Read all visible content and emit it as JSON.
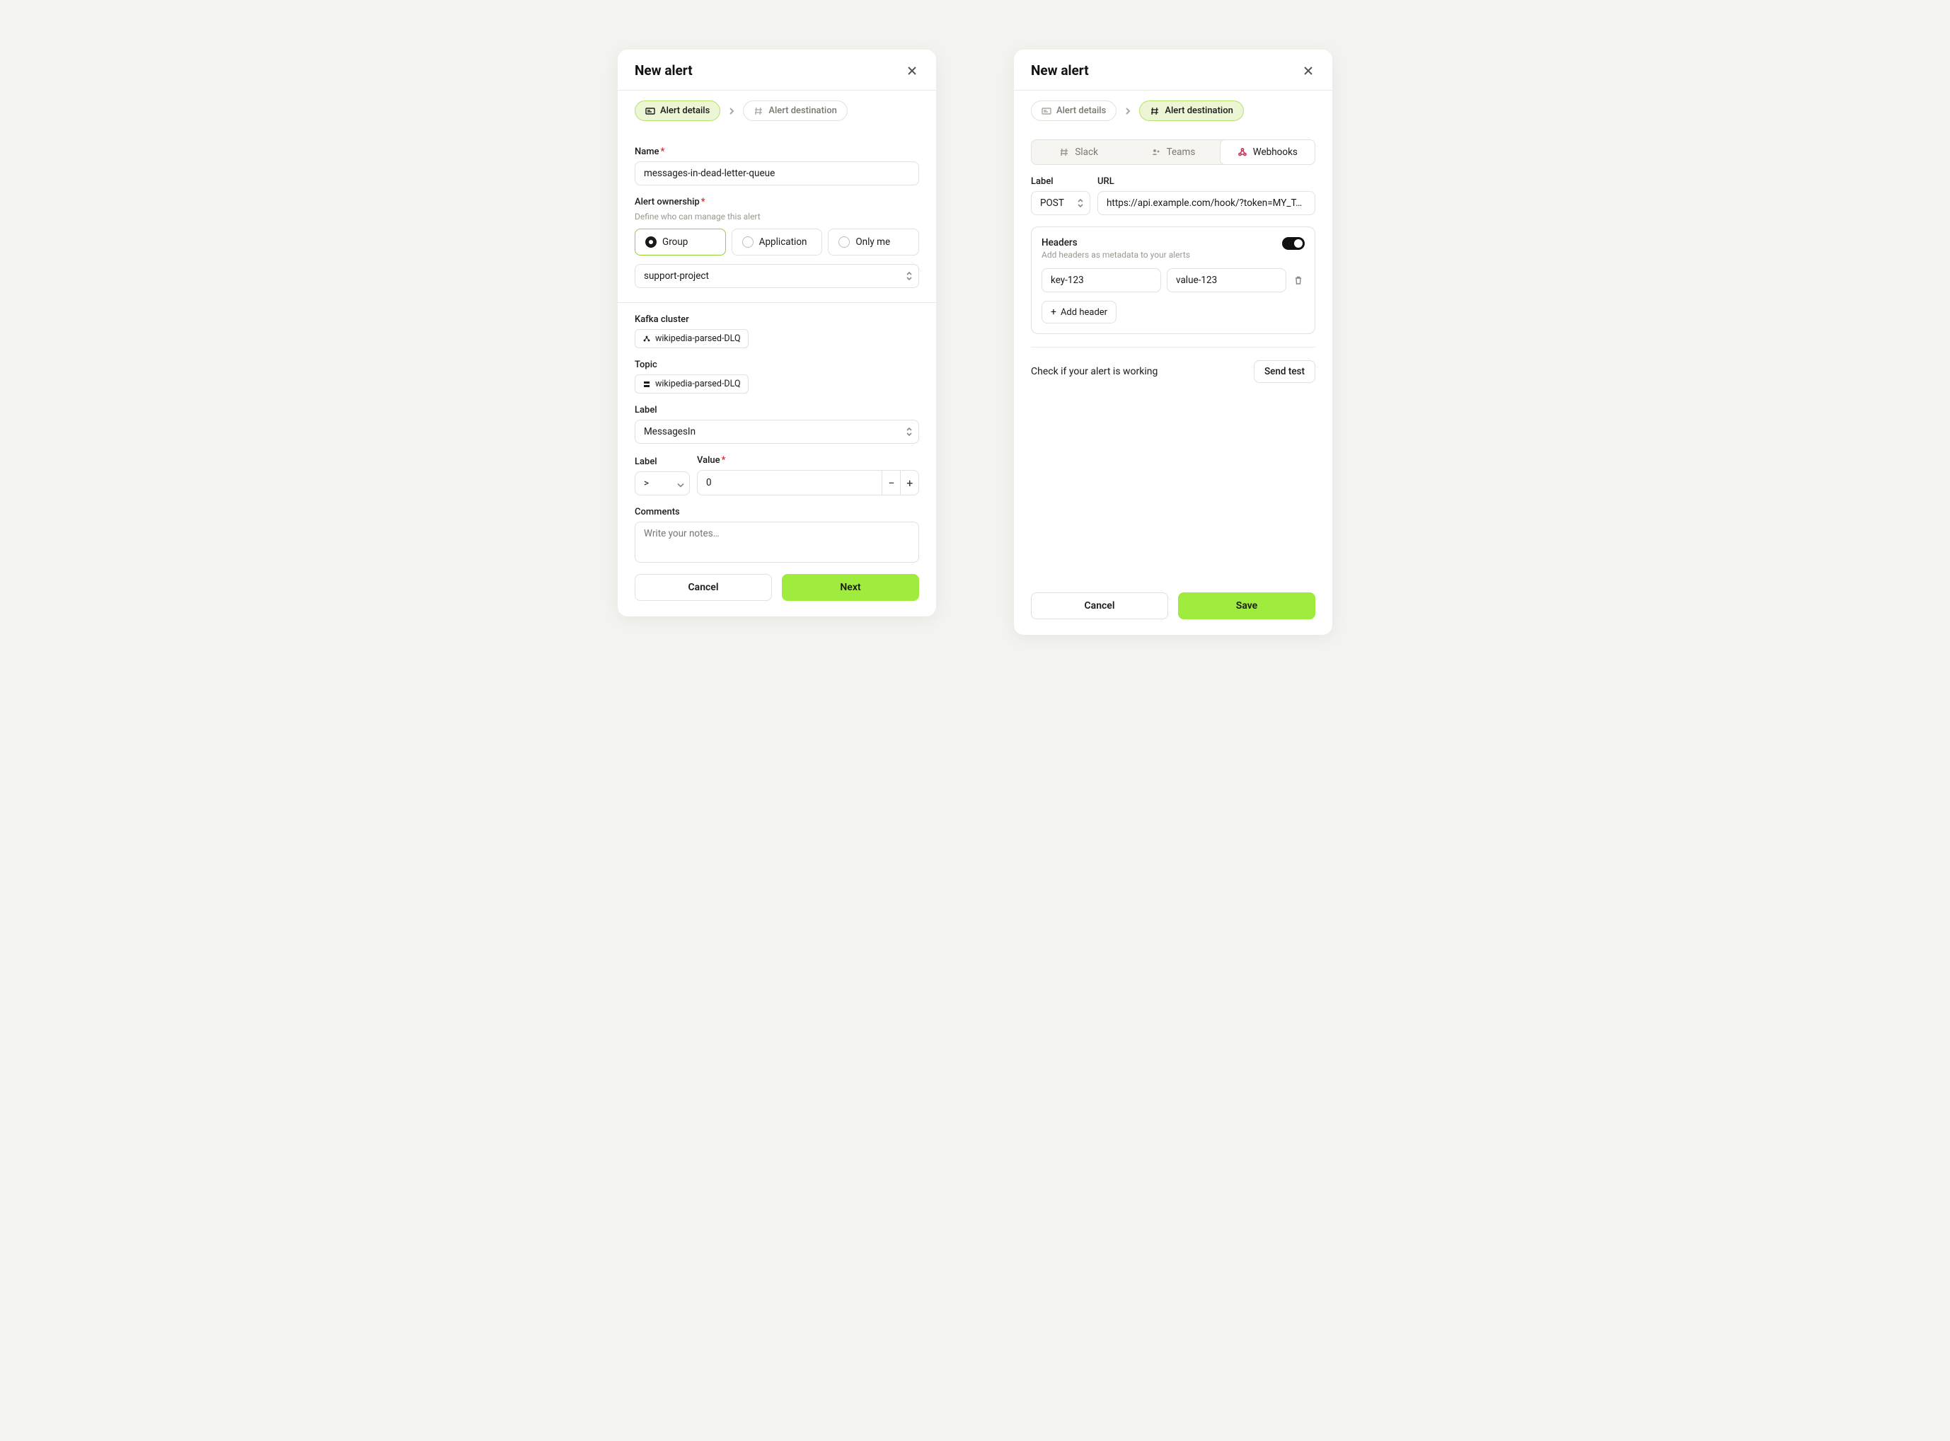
{
  "left": {
    "title": "New alert",
    "breadcrumb": {
      "details": "Alert details",
      "destination": "Alert destination"
    },
    "name": {
      "label": "Name",
      "value": "messages-in-dead-letter-queue"
    },
    "ownership": {
      "label": "Alert ownership",
      "help": "Define who can manage this alert",
      "options": {
        "group": "Group",
        "application": "Application",
        "only_me": "Only me"
      },
      "group_value": "support-project"
    },
    "kafka": {
      "label": "Kafka cluster",
      "value": "wikipedia-parsed-DLQ"
    },
    "topic": {
      "label": "Topic",
      "value": "wikipedia-parsed-DLQ"
    },
    "metric": {
      "label": "Label",
      "value": "MessagesIn"
    },
    "condition": {
      "operator_label": "Label",
      "operator": ">",
      "value_label": "Value",
      "value": "0"
    },
    "comments": {
      "label": "Comments",
      "placeholder": "Write your notes…"
    },
    "footer": {
      "cancel": "Cancel",
      "next": "Next"
    }
  },
  "right": {
    "title": "New alert",
    "breadcrumb": {
      "details": "Alert details",
      "destination": "Alert destination"
    },
    "tabs": {
      "slack": "Slack",
      "teams": "Teams",
      "webhooks": "Webhooks"
    },
    "webhook": {
      "label_label": "Label",
      "url_label": "URL",
      "method": "POST",
      "url": "https://api.example.com/hook/?token=MY_T…"
    },
    "headers": {
      "title": "Headers",
      "help": "Add headers as metadata to your alerts",
      "row": {
        "key": "key-123",
        "value": "value-123"
      },
      "add_label": "Add header"
    },
    "test": {
      "text": "Check if your alert is working",
      "button": "Send test"
    },
    "footer": {
      "cancel": "Cancel",
      "save": "Save"
    }
  }
}
